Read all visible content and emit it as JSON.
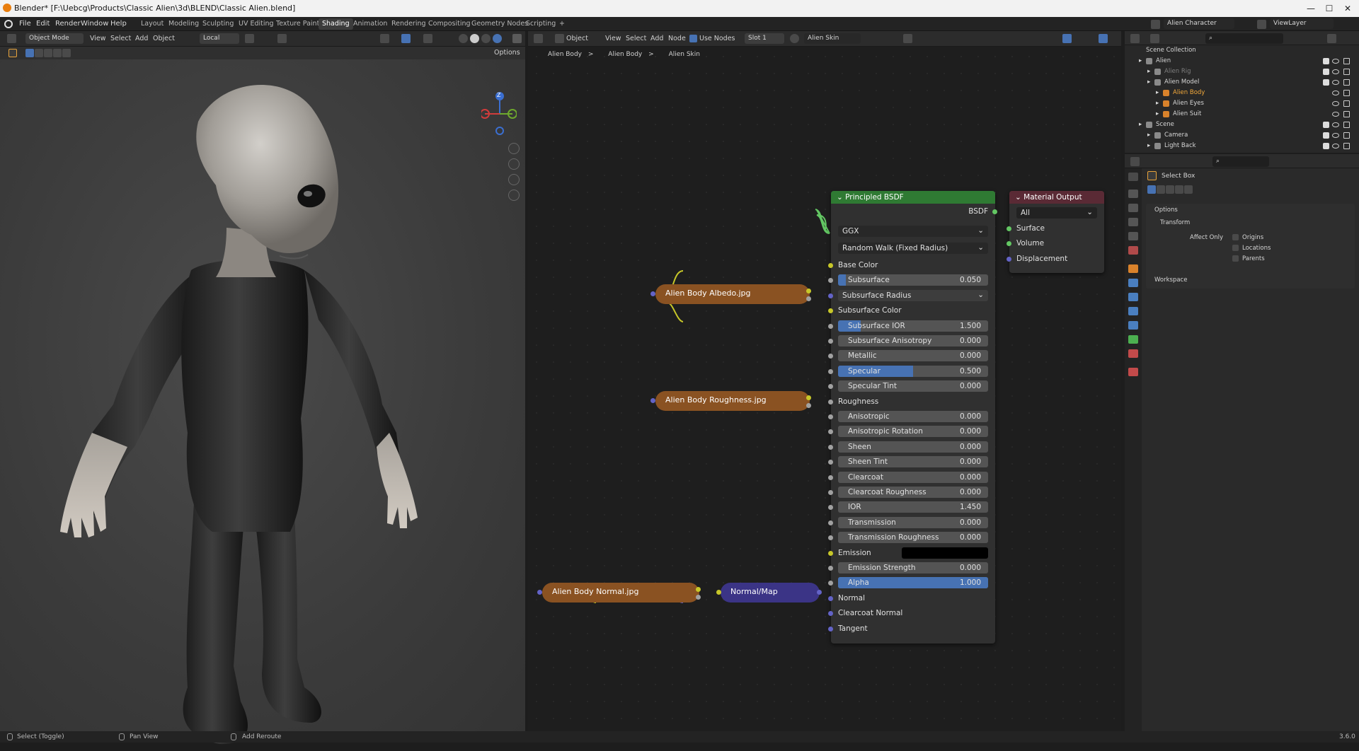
{
  "titlebar": {
    "title": "Blender* [F:\\Uebcg\\Products\\Classic Alien\\3d\\BLEND\\Classic Alien.blend]",
    "minimize": "—",
    "maximize": "☐",
    "close": "✕"
  },
  "menubar": {
    "items": [
      "File",
      "Edit",
      "Render",
      "Window",
      "Help"
    ],
    "workspaces": [
      "Layout",
      "Modeling",
      "Sculpting",
      "UV Editing",
      "Texture Paint",
      "Shading",
      "Animation",
      "Rendering",
      "Compositing",
      "Geometry Nodes",
      "Scripting"
    ],
    "active_workspace": "Shading",
    "add_workspace": "+",
    "scene_name": "Alien Character",
    "view_layer": "ViewLayer"
  },
  "viewport": {
    "mode": "Object Mode",
    "menus": [
      "View",
      "Select",
      "Add",
      "Object"
    ],
    "orientation": "Local",
    "options": "Options",
    "gizmo_z": "Z"
  },
  "node_editor": {
    "object_label": "Object",
    "menus": [
      "View",
      "Select",
      "Add",
      "Node"
    ],
    "use_nodes": "Use Nodes",
    "slot": "Slot 1",
    "material": "Alien Skin",
    "breadcrumb": [
      "Alien Body",
      "Alien Body",
      "Alien Skin"
    ]
  },
  "bsdf": {
    "title": "Principled BSDF",
    "output": "BSDF",
    "distribution": "GGX",
    "subsurface_method": "Random Walk (Fixed Radius)",
    "inputs": [
      {
        "label": "Base Color",
        "kind": "label",
        "socket": "yel"
      },
      {
        "label": "Subsurface",
        "kind": "slider",
        "value": "0.050",
        "fill": 0.05,
        "socket": "gry"
      },
      {
        "label": "Subsurface Radius",
        "kind": "dropdown",
        "socket": "pur"
      },
      {
        "label": "Subsurface Color",
        "kind": "label",
        "socket": "yel"
      },
      {
        "label": "Subsurface IOR",
        "kind": "slider",
        "value": "1.500",
        "fill": 0.15,
        "socket": "gry"
      },
      {
        "label": "Subsurface Anisotropy",
        "kind": "slider",
        "value": "0.000",
        "fill": 0,
        "socket": "gry"
      },
      {
        "label": "Metallic",
        "kind": "slider",
        "value": "0.000",
        "fill": 0,
        "socket": "gry"
      },
      {
        "label": "Specular",
        "kind": "slider",
        "value": "0.500",
        "fill": 0.5,
        "socket": "gry"
      },
      {
        "label": "Specular Tint",
        "kind": "slider",
        "value": "0.000",
        "fill": 0,
        "socket": "gry"
      },
      {
        "label": "Roughness",
        "kind": "label",
        "socket": "gry"
      },
      {
        "label": "Anisotropic",
        "kind": "slider",
        "value": "0.000",
        "fill": 0,
        "socket": "gry"
      },
      {
        "label": "Anisotropic Rotation",
        "kind": "slider",
        "value": "0.000",
        "fill": 0,
        "socket": "gry"
      },
      {
        "label": "Sheen",
        "kind": "slider",
        "value": "0.000",
        "fill": 0,
        "socket": "gry"
      },
      {
        "label": "Sheen Tint",
        "kind": "slider",
        "value": "0.000",
        "fill": 0,
        "socket": "gry"
      },
      {
        "label": "Clearcoat",
        "kind": "slider",
        "value": "0.000",
        "fill": 0,
        "socket": "gry"
      },
      {
        "label": "Clearcoat Roughness",
        "kind": "slider",
        "value": "0.000",
        "fill": 0,
        "socket": "gry"
      },
      {
        "label": "IOR",
        "kind": "slider",
        "value": "1.450",
        "fill": 0,
        "socket": "gry"
      },
      {
        "label": "Transmission",
        "kind": "slider",
        "value": "0.000",
        "fill": 0,
        "socket": "gry"
      },
      {
        "label": "Transmission Roughness",
        "kind": "slider",
        "value": "0.000",
        "fill": 0,
        "socket": "gry"
      },
      {
        "label": "Emission",
        "kind": "color",
        "socket": "yel"
      },
      {
        "label": "Emission Strength",
        "kind": "slider",
        "value": "0.000",
        "fill": 0,
        "socket": "gry"
      },
      {
        "label": "Alpha",
        "kind": "slider",
        "value": "1.000",
        "fill": 1,
        "socket": "gry"
      },
      {
        "label": "Normal",
        "kind": "label",
        "socket": "pur"
      },
      {
        "label": "Clearcoat Normal",
        "kind": "label",
        "socket": "pur"
      },
      {
        "label": "Tangent",
        "kind": "label",
        "socket": "pur"
      }
    ]
  },
  "matout": {
    "title": "Material Output",
    "target": "All",
    "inputs": [
      "Surface",
      "Volume",
      "Displacement"
    ]
  },
  "texnodes": {
    "albedo": "Alien Body Albedo.jpg",
    "roughness": "Alien Body Roughness.jpg",
    "normal": "Alien Body Normal.jpg",
    "normalmap": "Normal/Map"
  },
  "outliner": {
    "title": "Scene Collection",
    "items": [
      {
        "label": "Alien",
        "level": 1,
        "color": "#d6d6d6"
      },
      {
        "label": "Alien Rig",
        "level": 2,
        "color": "#7f7f7f"
      },
      {
        "label": "Alien Model",
        "level": 2,
        "color": "#d6d6d6"
      },
      {
        "label": "Alien Body",
        "level": 3,
        "color": "#f2a93b"
      },
      {
        "label": "Alien Eyes",
        "level": 3,
        "color": "#d6d6d6"
      },
      {
        "label": "Alien Suit",
        "level": 3,
        "color": "#d6d6d6"
      },
      {
        "label": "Scene",
        "level": 1,
        "color": "#d6d6d6"
      },
      {
        "label": "Camera",
        "level": 2,
        "color": "#d6d6d6"
      },
      {
        "label": "Light Back",
        "level": 2,
        "color": "#d6d6d6"
      }
    ]
  },
  "props": {
    "tool": "Select Box",
    "options": "Options",
    "transform": "Transform",
    "affect_only": "Affect Only",
    "checks": [
      "Origins",
      "Locations",
      "Parents"
    ],
    "workspace": "Workspace"
  },
  "status": {
    "left": "Select (Toggle)",
    "mid": "Pan View",
    "right": "Add Reroute",
    "version": "3.6.0"
  },
  "colors": {
    "bsdf_header": "#2f7a33",
    "matout_header": "#5a2a35",
    "texnode": "#8a5222",
    "normalnode": "#3b3486",
    "accent": "#4772b3"
  }
}
